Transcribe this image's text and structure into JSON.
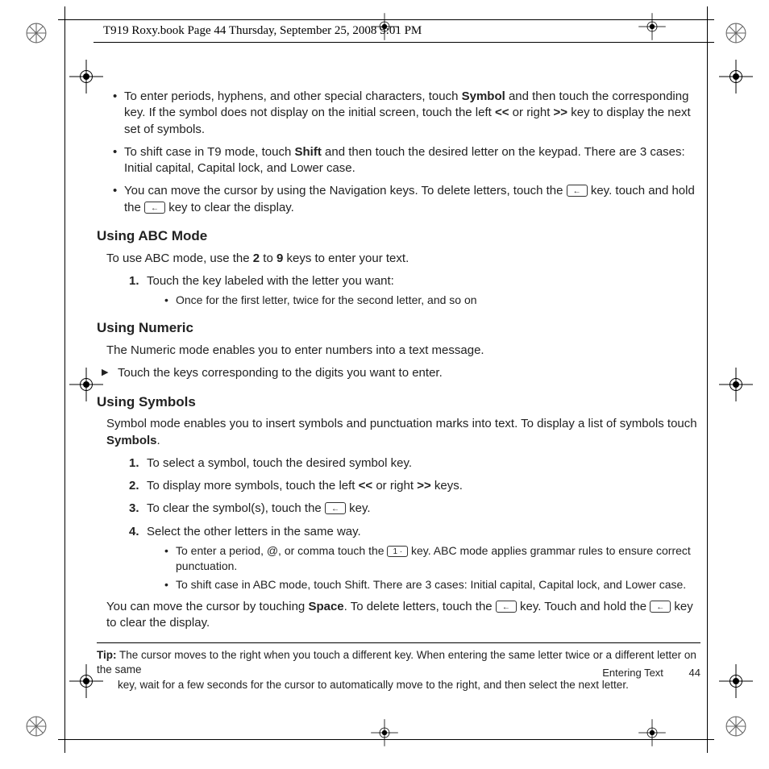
{
  "meta": {
    "runningHeader": "T919 Roxy.book  Page 44  Thursday, September 25, 2008  5:01 PM"
  },
  "top": {
    "bullets": [
      {
        "pre": "To enter periods, hyphens, and other special characters, touch ",
        "b1": "Symbol",
        "mid": " and then touch the corresponding key. If the symbol does not display on the initial screen, touch the left ",
        "b2": "<<",
        "mid2": " or right  ",
        "b3": ">>",
        "post": " key to display the next set of symbols."
      },
      {
        "pre": "To shift case in T9 mode, touch ",
        "b1": "Shift",
        "post": " and then touch the desired letter on the keypad. There are 3 cases: Initial capital, Capital lock, and Lower case."
      },
      {
        "pre": "You can move the cursor by using the Navigation keys. To delete letters, touch the ",
        "post": " key. touch and hold the ",
        "post2": " key to clear the display."
      }
    ]
  },
  "abc": {
    "heading": "Using ABC Mode",
    "intro": {
      "pre": "To use ABC mode, use the ",
      "b1": "2",
      "mid": " to ",
      "b2": "9",
      "post": " keys to enter your text."
    },
    "steps": [
      {
        "n": "1.",
        "text": "Touch the key labeled with the letter you want:",
        "sub": [
          "Once for the first letter, twice for the second letter, and so on"
        ]
      }
    ]
  },
  "numeric": {
    "heading": "Using Numeric",
    "intro": "The Numeric mode enables you to enter numbers into a text message.",
    "arrow": "Touch the keys corresponding to the digits you want to enter."
  },
  "symbols": {
    "heading": "Using Symbols",
    "intro": {
      "pre": "Symbol mode enables you to insert symbols and punctuation marks into text. To display a list of symbols touch ",
      "b1": "Symbols",
      "post": "."
    },
    "steps": [
      {
        "n": "1.",
        "text": "To select a symbol, touch the desired symbol key."
      },
      {
        "n": "2.",
        "pre": "To display more symbols, touch the left ",
        "b1": "<<",
        "mid": " or right ",
        "b2": ">>",
        "post": " keys."
      },
      {
        "n": "3.",
        "pre": "To clear the symbol(s), touch the ",
        "post": " key."
      },
      {
        "n": "4.",
        "text": "Select the other letters in the same way.",
        "sub": [
          {
            "pre": "To enter a period, @, or comma touch the ",
            "post": " key. ABC mode applies grammar rules to ensure correct punctuation."
          },
          {
            "text": "To shift case in ABC mode, touch Shift. There are 3 cases: Initial capital, Capital lock, and Lower case."
          }
        ]
      }
    ],
    "outro": {
      "pre": "You can move the cursor by touching ",
      "b1": "Space",
      "mid": ". To delete letters, touch the ",
      "mid2": " key. Touch and hold the ",
      "post": " key to clear the display."
    }
  },
  "tip": {
    "label": "Tip:",
    "line1": " The cursor moves to the right when you touch a different key. When entering the same letter twice or a different letter on the same",
    "line2": "key, wait for a few seconds for the cursor to automatically move to the right, and then select the next letter."
  },
  "footer": {
    "section": "Entering Text",
    "page": "44"
  },
  "keys": {
    "back": "←",
    "one": "1 ·"
  }
}
